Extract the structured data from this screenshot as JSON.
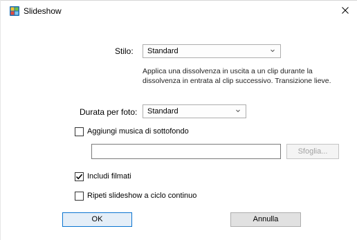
{
  "window": {
    "title": "Slideshow"
  },
  "style": {
    "label": "Stilo:",
    "value": "Standard",
    "description_line1": "Applica una dissolvenza in uscita a un clip durante la",
    "description_line2": "dissolvenza in entrata al clip successivo. Transizione lieve."
  },
  "duration": {
    "label": "Durata per foto:",
    "value": "Standard"
  },
  "music": {
    "label": "Aggiungi musica di sottofondo",
    "checked": false,
    "path": "",
    "browse_label": "Sfoglia..."
  },
  "include_videos": {
    "label": "Includi filmati",
    "checked": true
  },
  "loop": {
    "label": "Ripeti slideshow a ciclo continuo",
    "checked": false
  },
  "buttons": {
    "ok": "OK",
    "cancel": "Annulla"
  },
  "colors": {
    "ok_border": "#0a74d0",
    "ok_bg": "#e4eef8",
    "disabled_text": "#a2a2a2"
  }
}
